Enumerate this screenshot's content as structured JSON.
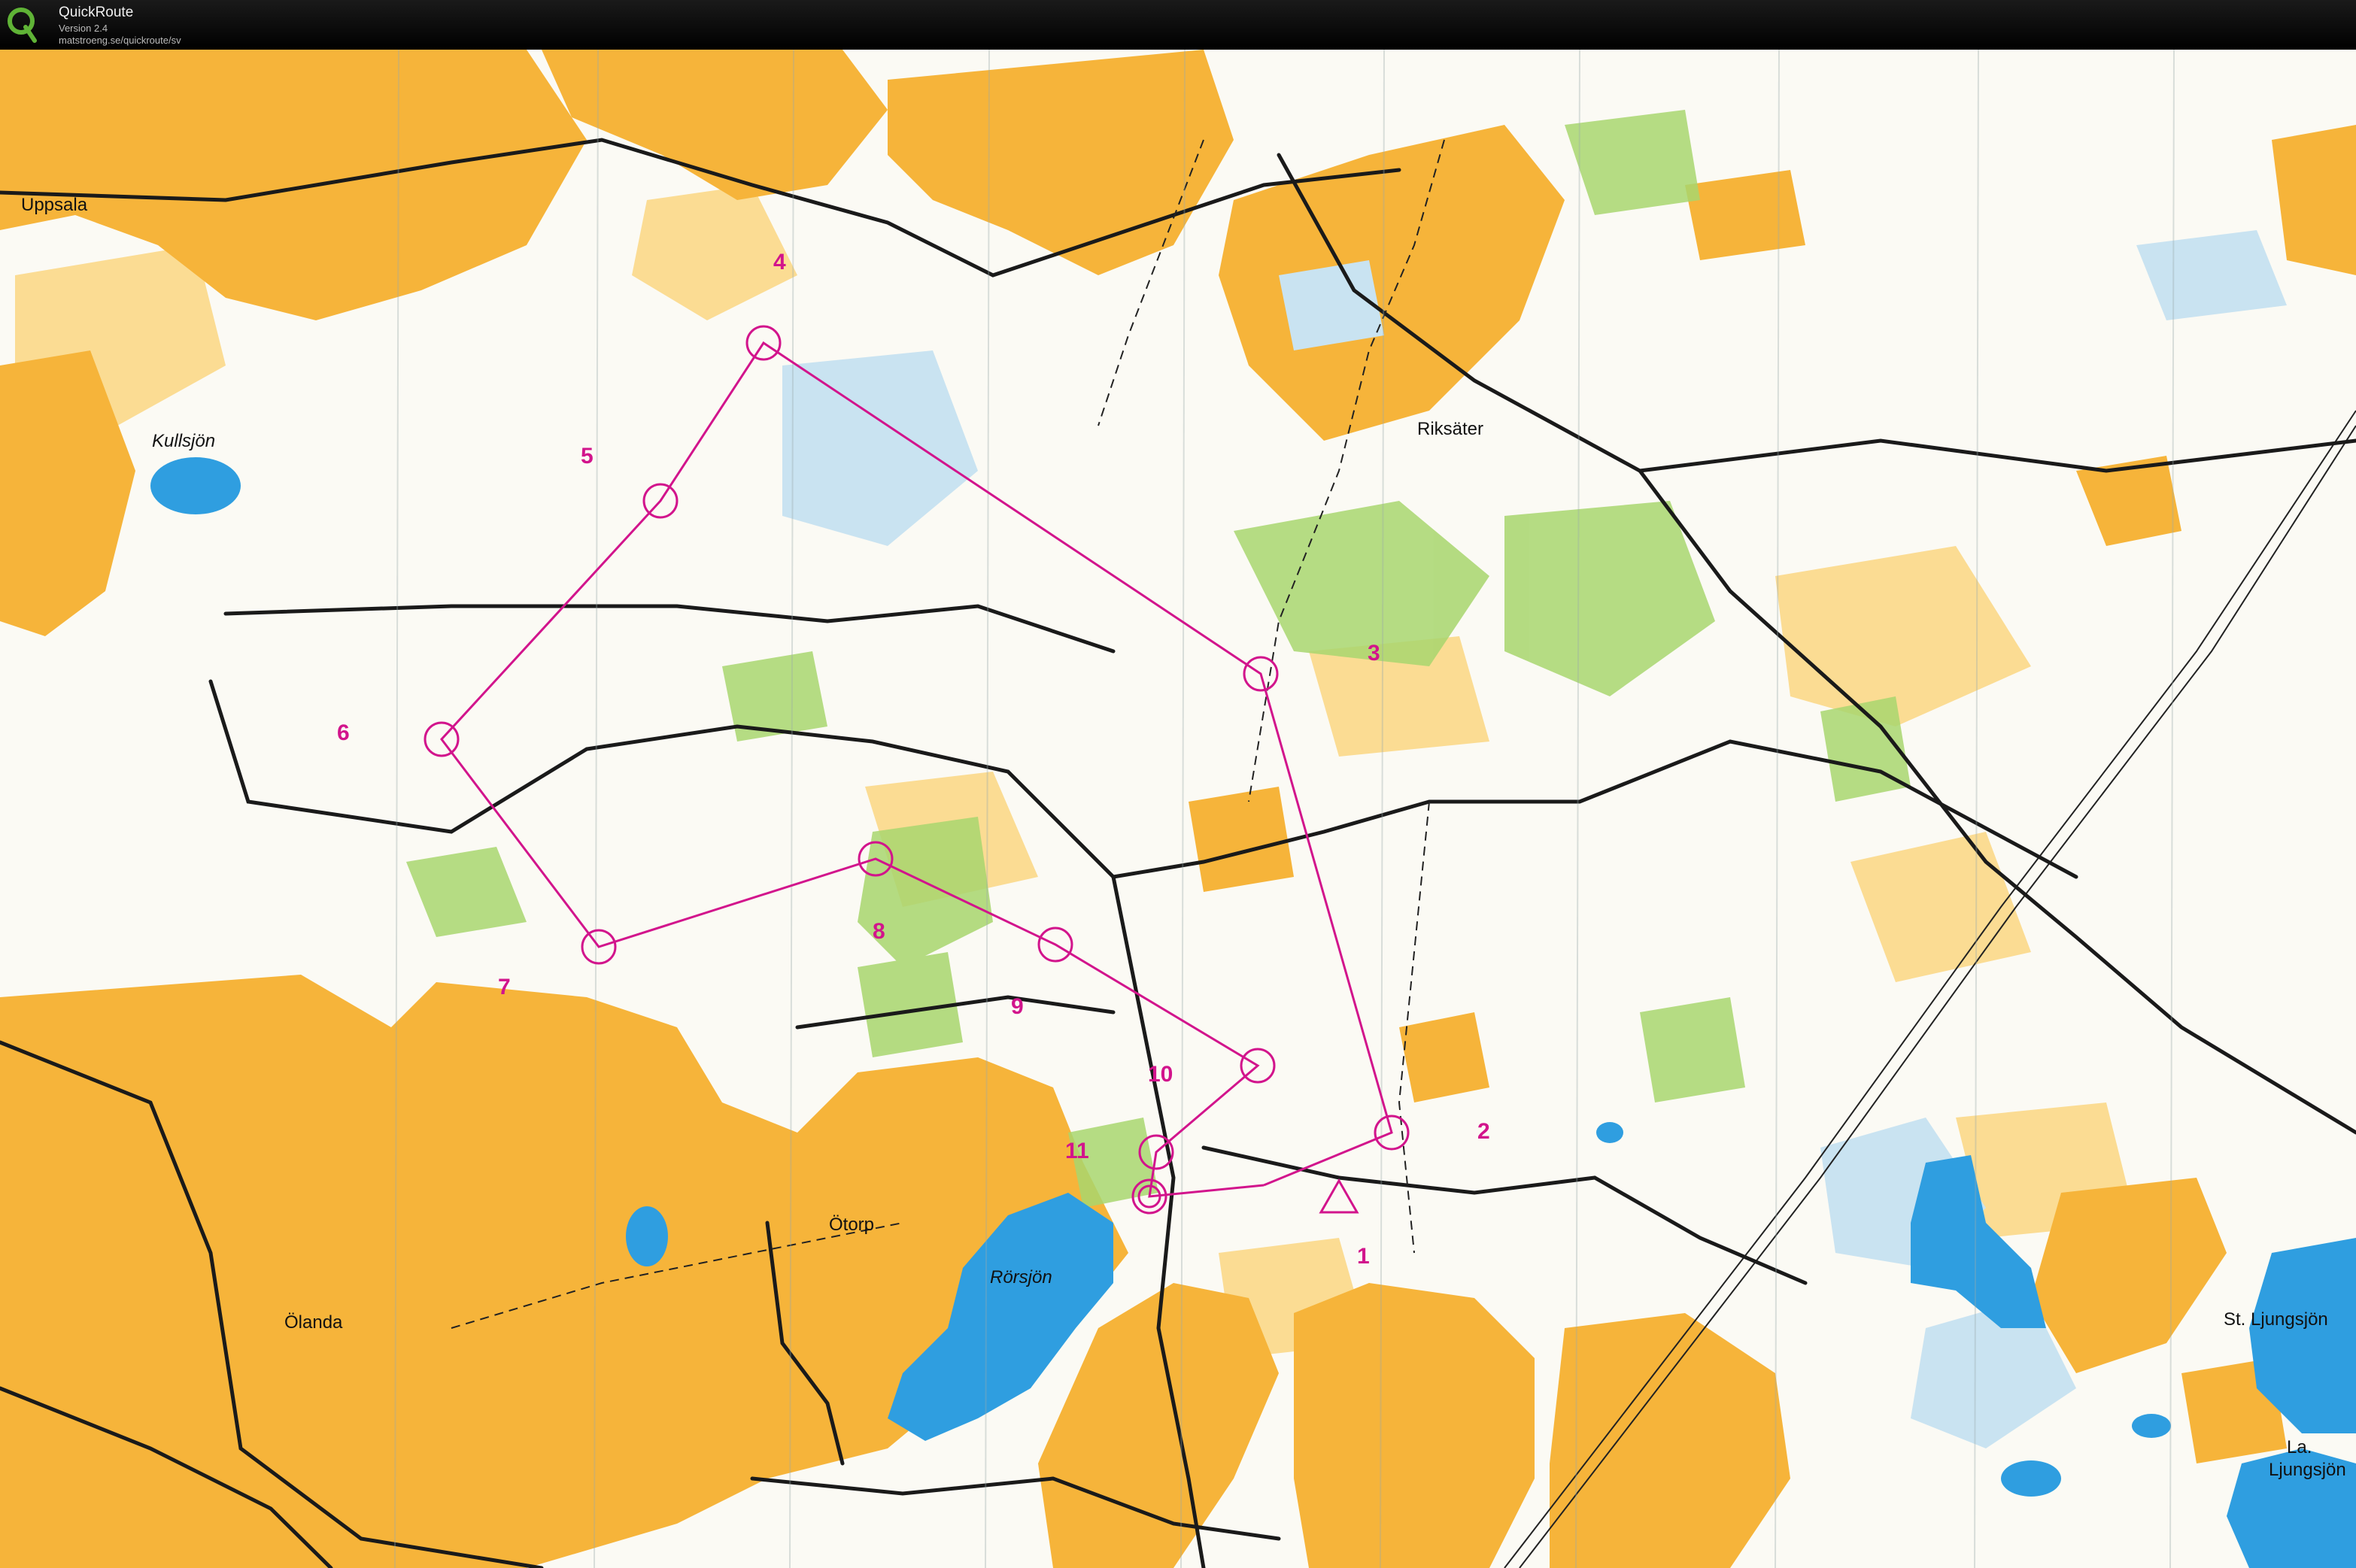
{
  "app": {
    "name": "QuickRoute",
    "version": "Version 2.4",
    "url": "matstroeng.se/quickroute/sv",
    "logo_icon": "quickroute-q-logo-icon"
  },
  "map": {
    "type": "orienteering-map",
    "colors": {
      "open_land": "#f6b43a",
      "semi_open": "#fbdc93",
      "forest": "#fbfaf4",
      "green_vegetation": "#a8d66e",
      "water": "#2f9ee0",
      "marsh": "#c9e3f1",
      "course": "#d2148c",
      "road": "#1a1a1a"
    },
    "place_names": {
      "uppsala": "Uppsala",
      "kullsjon": "Kullsjön",
      "riksater": "Riksäter",
      "otorp": "Ötorp",
      "rorsjon": "Rörsjön",
      "olanda": "Ölanda",
      "st_ljungsjon": "St. Ljungsjön",
      "la_ljungsjon_1": "La.",
      "la_ljungsjon_2": "Ljungsjön"
    },
    "controls": [
      {
        "label": "1"
      },
      {
        "label": "2"
      },
      {
        "label": "3"
      },
      {
        "label": "4"
      },
      {
        "label": "5"
      },
      {
        "label": "6"
      },
      {
        "label": "7"
      },
      {
        "label": "8"
      },
      {
        "label": "9"
      },
      {
        "label": "10"
      },
      {
        "label": "11"
      }
    ]
  }
}
